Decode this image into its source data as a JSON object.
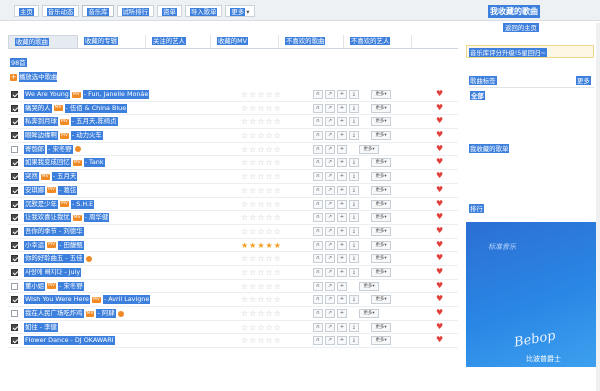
{
  "nav": {
    "tabs": [
      "主页",
      "音乐动态",
      "音乐库",
      "试听排行",
      "资单",
      "导入歌单",
      "更多"
    ],
    "active_index": 2,
    "more_caret": "▾"
  },
  "profile": {
    "title": "我收藏的歌曲",
    "link": "返回的主页"
  },
  "content_tabs": [
    "收藏的歌曲",
    "收藏的专辑",
    "关注的艺人",
    "收藏的MV",
    "不喜欢的歌曲",
    "不喜欢的艺人"
  ],
  "song_count": "98首",
  "add_label": "播放选中歌曲",
  "stars_empty": "☆☆☆☆☆",
  "stars_full": "★★★★★",
  "more_label": "更多",
  "heart": "♥",
  "mv_badge": "MV",
  "songs": [
    {
      "title": "We Are Young",
      "mv": true,
      "artist": " - Fun, Janelle Monáe",
      "checked": true,
      "stars": 0,
      "actions": 4
    },
    {
      "title": "痛哭的人",
      "mv": true,
      "artist": " - 伍佰 & China Blue",
      "checked": true,
      "stars": 0,
      "actions": 4
    },
    {
      "title": "私奔到月球",
      "mv": true,
      "artist": " - 五月天,陈绮贞",
      "checked": true,
      "stars": 0,
      "actions": 4
    },
    {
      "title": "眼眸边缘啊",
      "mv": true,
      "artist": " - 动力火车",
      "checked": true,
      "stars": 0,
      "actions": 4
    },
    {
      "title": "寄匏郎",
      "mv": false,
      "artist": " - 宋冬野",
      "checked": false,
      "stars": 0,
      "actions": 3,
      "hq": true
    },
    {
      "title": "如果我变成回忆",
      "mv": true,
      "artist": " - Tank",
      "checked": true,
      "stars": 0,
      "actions": 4
    },
    {
      "title": "突然",
      "mv": true,
      "artist": " - 五月天",
      "checked": true,
      "stars": 0,
      "actions": 4
    },
    {
      "title": "安琪娜",
      "mv": true,
      "artist": " - 葛弦",
      "checked": true,
      "stars": 0,
      "actions": 4
    },
    {
      "title": "沉默是少年",
      "mv": true,
      "artist": " - S.H.E",
      "checked": true,
      "stars": 0,
      "actions": 4
    },
    {
      "title": "让我欢喜让我忧",
      "mv": true,
      "artist": " - 周华健",
      "checked": true,
      "stars": 0,
      "actions": 4
    },
    {
      "title": "吾你的季节 - 刘德华",
      "mv": false,
      "artist": "",
      "checked": true,
      "stars": 0,
      "actions": 4
    },
    {
      "title": "小幸运",
      "mv": true,
      "artist": " - 田馥甄",
      "checked": true,
      "stars": 5,
      "actions": 4
    },
    {
      "title": "你的好聆曲五 - 五佳",
      "mv": false,
      "artist": "",
      "checked": true,
      "stars": 0,
      "actions": 4,
      "hq": true
    },
    {
      "title": "사랑에 빠지다 - July",
      "mv": false,
      "artist": "",
      "checked": true,
      "stars": 0,
      "actions": 4
    },
    {
      "title": "董小姐",
      "mv": true,
      "artist": " - 宋冬野",
      "checked": false,
      "stars": 0,
      "actions": 3
    },
    {
      "title": "Wish You Were Here",
      "mv": true,
      "artist": " - Avril Lavigne",
      "checked": true,
      "stars": 0,
      "actions": 4
    },
    {
      "title": "我在人民广场吃炸鸡",
      "mv": true,
      "artist": " - 阿肆",
      "checked": false,
      "stars": 0,
      "actions": 3,
      "hq": true
    },
    {
      "title": "如往 - 李健",
      "mv": false,
      "artist": "",
      "checked": true,
      "stars": 0,
      "actions": 4
    },
    {
      "title": "Flower Dance - DJ OKAWARI",
      "mv": false,
      "artist": "",
      "checked": true,
      "stars": 0,
      "actions": 4
    }
  ],
  "sidebar": {
    "notice": "音乐库评分升级!5星回归~",
    "tags_title": "歌曲标签",
    "tags_more": "更多",
    "tag_all": "全部",
    "fav_title": "我收藏的歌单",
    "rank_title": "排行",
    "banner_caption": "Bebop",
    "banner_sub": "比波普爵士",
    "banner_small": "标准音乐"
  },
  "colors": {
    "selection": "#3d7fdc",
    "accent": "#f08a24",
    "heart": "#e0413a",
    "star": "#f39c1d"
  }
}
